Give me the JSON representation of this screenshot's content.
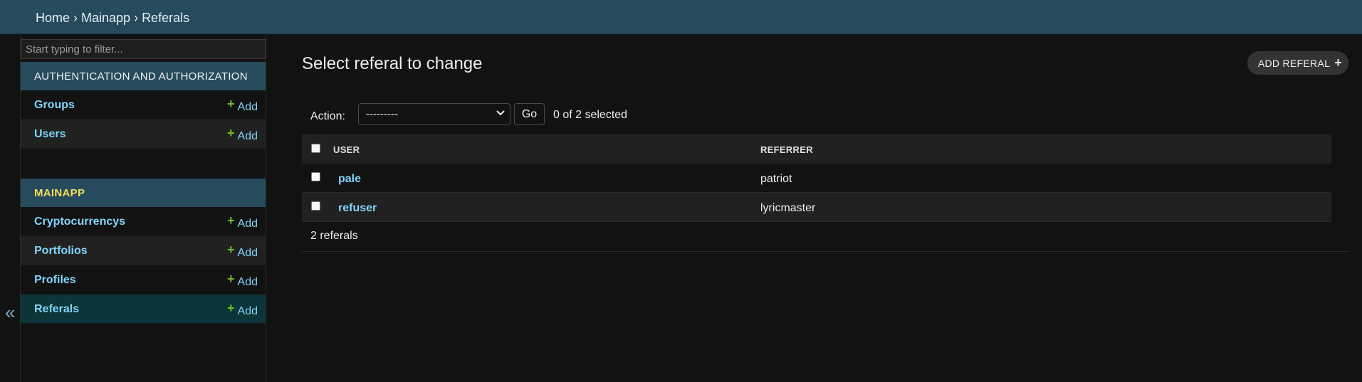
{
  "breadcrumbs": {
    "home": "Home",
    "sep1": "›",
    "app": "Mainapp",
    "sep2": "›",
    "current": "Referals"
  },
  "sidebar": {
    "toggle_glyph": "«",
    "filter_placeholder": "Start typing to filter...",
    "modules": [
      {
        "caption": "AUTHENTICATION AND AUTHORIZATION",
        "models": [
          {
            "name": "Groups",
            "add": "Add"
          },
          {
            "name": "Users",
            "add": "Add"
          }
        ]
      },
      {
        "caption": "MAINAPP",
        "models": [
          {
            "name": "Cryptocurrencys",
            "add": "Add"
          },
          {
            "name": "Portfolios",
            "add": "Add"
          },
          {
            "name": "Profiles",
            "add": "Add"
          },
          {
            "name": "Referals",
            "add": "Add"
          }
        ]
      }
    ],
    "add_glyph": "+"
  },
  "content": {
    "title": "Select referal to change",
    "add_button": "ADD REFERAL",
    "add_glyph": "+",
    "action_label": "Action:",
    "action_selected": "---------",
    "go_label": "Go",
    "selected_count": "0 of 2 selected",
    "columns": [
      "USER",
      "REFERRER"
    ],
    "rows": [
      {
        "user": "pale",
        "referrer": "patriot"
      },
      {
        "user": "refuser",
        "referrer": "lyricmaster"
      }
    ],
    "paginator": "2 referals"
  },
  "colors": {
    "header": "#264b5d",
    "link": "#81d4fa",
    "add_plus": "#70bf2b",
    "current_row": "#0b3538"
  }
}
